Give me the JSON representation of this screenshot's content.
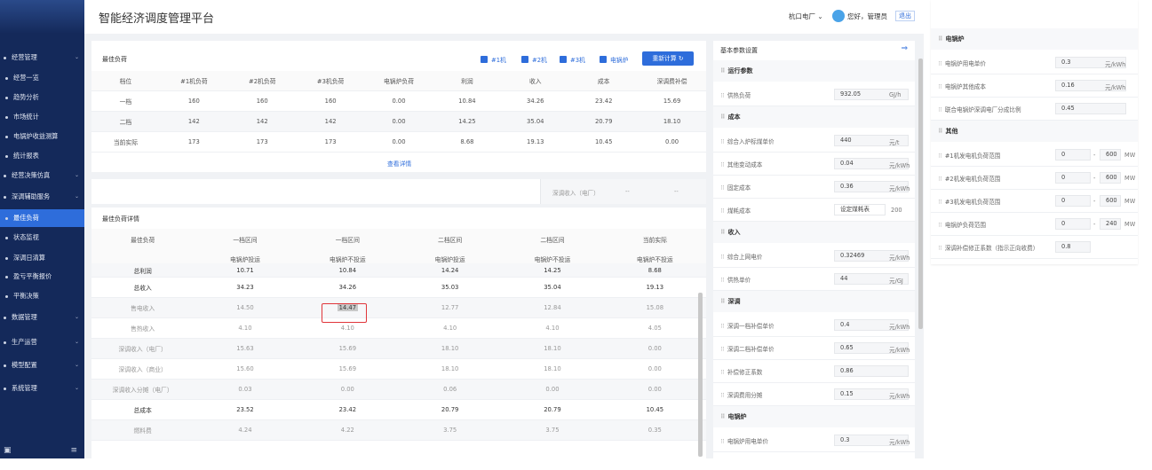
{
  "app": {
    "title": "智能经济调度管理平台",
    "factory": "杭口电厂",
    "greeting": "您好，管理员",
    "logout": "退出"
  },
  "sidebar": {
    "items": [
      {
        "label": "经营管理",
        "type": "group"
      },
      {
        "label": "经营一览",
        "type": "sub"
      },
      {
        "label": "趋势分析",
        "type": "sub"
      },
      {
        "label": "市场统计",
        "type": "sub"
      },
      {
        "label": "电锅炉收益测算",
        "type": "sub"
      },
      {
        "label": "统计报表",
        "type": "sub"
      },
      {
        "label": "经营决策仿真",
        "type": "group"
      },
      {
        "label": "深调辅助服务",
        "type": "group"
      },
      {
        "label": "最佳负荷",
        "type": "sub",
        "active": true
      },
      {
        "label": "状态监视",
        "type": "sub"
      },
      {
        "label": "深调日清算",
        "type": "sub"
      },
      {
        "label": "盈亏平衡报价",
        "type": "sub"
      },
      {
        "label": "平衡决策",
        "type": "sub"
      },
      {
        "label": "数据管理",
        "type": "group"
      },
      {
        "label": "生产运营",
        "type": "group"
      },
      {
        "label": "模型配置",
        "type": "group"
      },
      {
        "label": "系统管理",
        "type": "group"
      }
    ],
    "bottom_left_icon": "▣",
    "bottom_right_icon": "≡"
  },
  "best_load": {
    "title": "最佳负荷",
    "checkboxes": [
      "#1机",
      "#2机",
      "#3机",
      "电锅炉"
    ],
    "recalc_button": "重新计算",
    "view_detail": "查看详情",
    "headers": [
      "档位",
      "#1机负荷",
      "#2机负荷",
      "#3机负荷",
      "电锅炉负荷",
      "利润",
      "收入",
      "成本",
      "深调费补偿"
    ],
    "rows": [
      [
        "一档",
        "160",
        "160",
        "160",
        "0.00",
        "10.84",
        "34.26",
        "23.42",
        "15.69"
      ],
      [
        "二档",
        "142",
        "142",
        "142",
        "0.00",
        "14.25",
        "35.04",
        "20.79",
        "18.10"
      ],
      [
        "当前实际",
        "173",
        "173",
        "173",
        "0.00",
        "8.68",
        "19.13",
        "10.45",
        "0.00"
      ]
    ]
  },
  "deep_income": {
    "label": "深调收入（电厂）",
    "v1": "--",
    "v2": "--"
  },
  "detail": {
    "title": "最佳负荷详情",
    "headers": [
      "最佳负荷",
      "一档区间",
      "一档区间",
      "二档区间",
      "二档区间",
      "当前实际"
    ],
    "subheaders": [
      "",
      "电锅炉投运",
      "电锅炉不投运",
      "电锅炉投运",
      "电锅炉不投运",
      "电锅炉不投运"
    ],
    "rows": [
      {
        "cells": [
          "总利润",
          "10.71",
          "10.84",
          "14.24",
          "14.25",
          "8.68"
        ],
        "style": "strong"
      },
      {
        "cells": [
          "总收入",
          "34.23",
          "34.26",
          "35.03",
          "35.04",
          "19.13"
        ],
        "style": "strong"
      },
      {
        "cells": [
          "售电收入",
          "14.50",
          "14.47",
          "12.77",
          "12.84",
          "15.08"
        ],
        "style": "faint"
      },
      {
        "cells": [
          "售热收入",
          "4.10",
          "4.10",
          "4.10",
          "4.10",
          "4.05"
        ],
        "style": "faint"
      },
      {
        "cells": [
          "深调收入（电厂）",
          "15.63",
          "15.69",
          "18.10",
          "18.10",
          "0.00"
        ],
        "style": "faint"
      },
      {
        "cells": [
          "深调收入（商业）",
          "15.60",
          "15.69",
          "18.10",
          "18.10",
          "0.00"
        ],
        "style": "faint"
      },
      {
        "cells": [
          "深调收入分摊（电厂）",
          "0.03",
          "0.00",
          "0.06",
          "0.00",
          "0.00"
        ],
        "style": "faint"
      },
      {
        "cells": [
          "总成本",
          "23.52",
          "23.42",
          "20.79",
          "20.79",
          "10.45"
        ],
        "style": "strong"
      },
      {
        "cells": [
          "燃料费",
          "4.24",
          "4.22",
          "3.75",
          "3.75",
          "0.35"
        ],
        "style": "faint"
      }
    ]
  },
  "params": {
    "title": "基本参数设置",
    "sections": [
      {
        "name": "运行参数",
        "rows": [
          {
            "label": "供热负荷",
            "value": "932.05",
            "unit": "GJ/h"
          }
        ]
      },
      {
        "name": "成本",
        "rows": [
          {
            "label": "综合入炉标煤单价",
            "value": "440",
            "unit": "元/t"
          },
          {
            "label": "其他变动成本",
            "value": "0.04",
            "unit": "元/kWh"
          },
          {
            "label": "固定成本",
            "value": "0.36",
            "unit": "元/kWh"
          },
          {
            "label": "煤耗成本",
            "value": "设定煤耗表",
            "unit": "200"
          }
        ]
      },
      {
        "name": "收入",
        "rows": [
          {
            "label": "综合上网电价",
            "value": "0.32469",
            "unit": "元/kWh"
          },
          {
            "label": "供热单价",
            "value": "44",
            "unit": "元/GJ"
          }
        ]
      },
      {
        "name": "深调",
        "rows": [
          {
            "label": "深调一档补偿单价",
            "value": "0.4",
            "unit": "元/kWh"
          },
          {
            "label": "深调二档补偿单价",
            "value": "0.65",
            "unit": "元/kWh"
          },
          {
            "label": "补偿修正系数",
            "value": "0.86",
            "unit": ""
          },
          {
            "label": "深调费用分摊",
            "value": "0.15",
            "unit": "元/kWh"
          }
        ]
      },
      {
        "name": "电锅炉",
        "rows": [
          {
            "label": "电锅炉用电单价",
            "value": "0.3",
            "unit": "元/kWh"
          }
        ]
      }
    ]
  },
  "params2": {
    "sections": [
      {
        "name": "电锅炉",
        "rows": [
          {
            "label": "电锅炉用电单价",
            "value": "0.3",
            "unit": "元/kWh"
          },
          {
            "label": "电锅炉其他成本",
            "value": "0.16",
            "unit": "元/kWh"
          },
          {
            "label": "联合电锅炉深调电厂分成比例",
            "value": "0.45",
            "unit": ""
          }
        ]
      },
      {
        "name": "其他",
        "rows": [
          {
            "label": "#1机发电机负荷范围",
            "value": "0",
            "to": "600",
            "unit": "MW"
          },
          {
            "label": "#2机发电机负荷范围",
            "value": "0",
            "to": "600",
            "unit": "MW"
          },
          {
            "label": "#3机发电机负荷范围",
            "value": "0",
            "to": "600",
            "unit": "MW"
          },
          {
            "label": "电锅炉负荷范围",
            "value": "0",
            "to": "240",
            "unit": "MW"
          },
          {
            "label": "深调补偿修正系数（指示正向收费）",
            "value": "0.8",
            "to": "",
            "unit": ""
          }
        ]
      }
    ]
  }
}
